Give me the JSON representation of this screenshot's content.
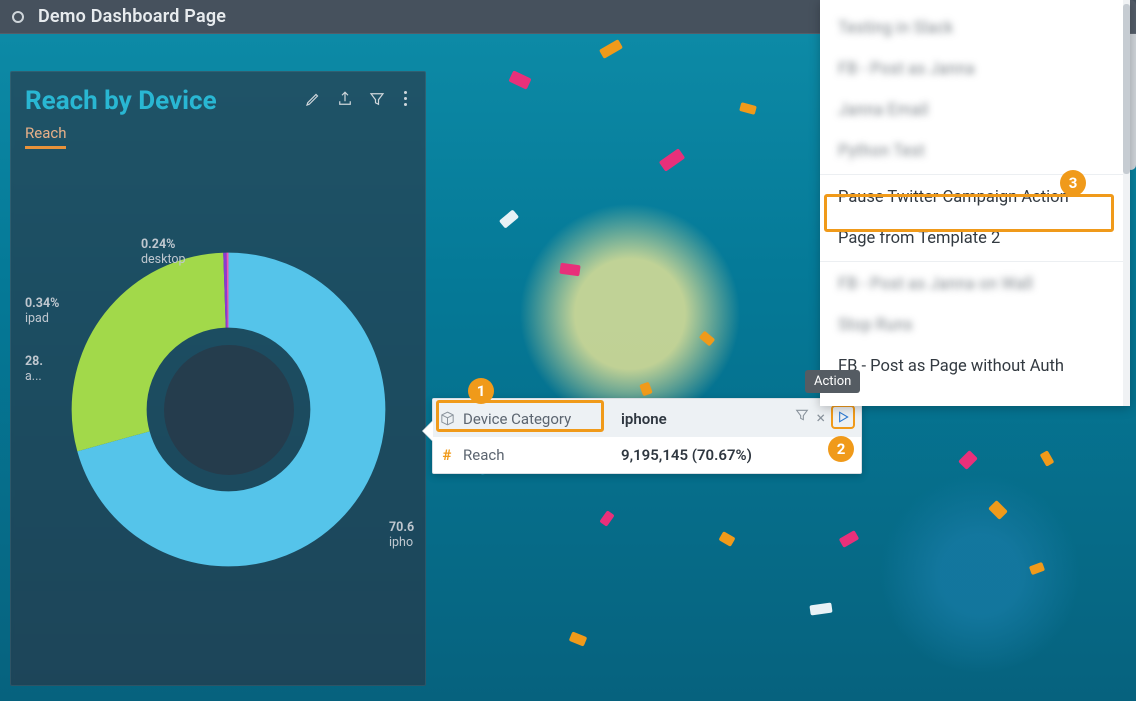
{
  "header": {
    "title": "Demo Dashboard Page"
  },
  "widget": {
    "title": "Reach by Device",
    "tab": "Reach",
    "labels": {
      "desktop_pct": "0.24%",
      "desktop_txt": "desktop",
      "ipad_pct": "0.34%",
      "ipad_txt": "ipad",
      "android_pct": "28.",
      "android_txt": "a...",
      "iphone_pct": "70.6",
      "iphone_txt": "ipho"
    }
  },
  "chart_data": {
    "type": "pie",
    "title": "Reach by Device",
    "series_name": "Reach",
    "categories": [
      "iphone",
      "android",
      "ipad",
      "desktop"
    ],
    "values": [
      70.67,
      28.75,
      0.34,
      0.24
    ],
    "colors": [
      "#55c4ea",
      "#a2d94a",
      "#8a3bd1",
      "#f054b3"
    ]
  },
  "tooltip": {
    "dim_label": "Device Category",
    "dim_value": "iphone",
    "metric_label": "Reach",
    "metric_value": "9,195,145 (70.67%)",
    "action_tip": "Action"
  },
  "panel": {
    "items": [
      {
        "label": "Testing in Slack",
        "blur": true
      },
      {
        "label": "FB - Post as Janna",
        "blur": true
      },
      {
        "label": "Janna Email",
        "blur": true
      },
      {
        "label": "Python Test",
        "blur": true
      },
      {
        "label": "Pause Twitter Campaign Action",
        "blur": false
      },
      {
        "label": "Page from Template 2",
        "blur": false
      },
      {
        "label": "FB - Post as Janna on Wall",
        "blur": true
      },
      {
        "label": "Stop Runs",
        "blur": true
      },
      {
        "label": "FB - Post as Page without Auth",
        "blur": false
      }
    ]
  },
  "badges": {
    "b1": "1",
    "b2": "2",
    "b3": "3"
  }
}
